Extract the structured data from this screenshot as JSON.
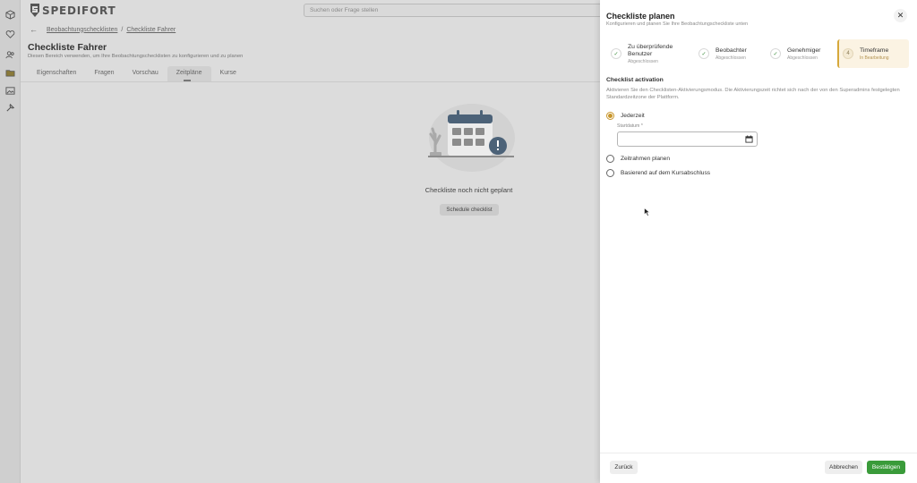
{
  "app": {
    "logo_text": "SPEDIFORT"
  },
  "search": {
    "placeholder": "Suchen oder Frage stellen"
  },
  "sidebar": {
    "icons": [
      "cube-icon",
      "heart-icon",
      "users-icon",
      "folder-icon",
      "image-icon",
      "tools-icon"
    ]
  },
  "breadcrumb": {
    "parent": "Beobachtungschecklisten",
    "separator": "/",
    "current": "Checkliste Fahrer"
  },
  "page": {
    "title": "Checkliste Fahrer",
    "subtitle": "Diesen Bereich verwenden, um Ihre Beobachtungschecklisten zu konfigurieren und zu planen"
  },
  "tabs": [
    {
      "label": "Eigenschaften"
    },
    {
      "label": "Fragen"
    },
    {
      "label": "Vorschau"
    },
    {
      "label": "Zeitpläne",
      "active": true
    },
    {
      "label": "Kurse"
    }
  ],
  "empty_state": {
    "title": "Checkliste noch nicht geplant",
    "button": "Schedule checklist"
  },
  "drawer": {
    "title": "Checkliste planen",
    "subtitle": "Konfigurieren und planen Sie Ihre Beobachtungscheckliste unten",
    "steps": [
      {
        "label": "Zu überprüfende Benutzer",
        "state": "Abgeschlossen",
        "icon": "check-icon"
      },
      {
        "label": "Beobachter",
        "state": "Abgeschlossen",
        "icon": "check-icon"
      },
      {
        "label": "Genehmiger",
        "state": "Abgeschlossen",
        "icon": "check-icon"
      },
      {
        "label": "Timeframe",
        "state": "In Bearbeitung",
        "number": "4",
        "active": true
      }
    ],
    "section_title": "Checklist activation",
    "section_desc": "Aktivieren Sie den Checklisten-Aktivierungsmodus. Die Aktivierungszeit richtet sich nach der von den Superadmins festgelegten Standardzeitzone der Plattform.",
    "options": [
      {
        "label": "Jederzeit",
        "selected": true
      },
      {
        "label": "Zeitrahmen planen",
        "selected": false
      },
      {
        "label": "Basierend auf dem Kursabschluss",
        "selected": false
      }
    ],
    "start_date": {
      "label": "Startdatum *",
      "value": ""
    },
    "buttons": {
      "back": "Zurück",
      "cancel": "Abbrechen",
      "confirm": "Bestätigen"
    }
  },
  "colors": {
    "accent": "#c8952b",
    "confirm": "#3a9b3a",
    "overlay": "#dcdcdc"
  }
}
